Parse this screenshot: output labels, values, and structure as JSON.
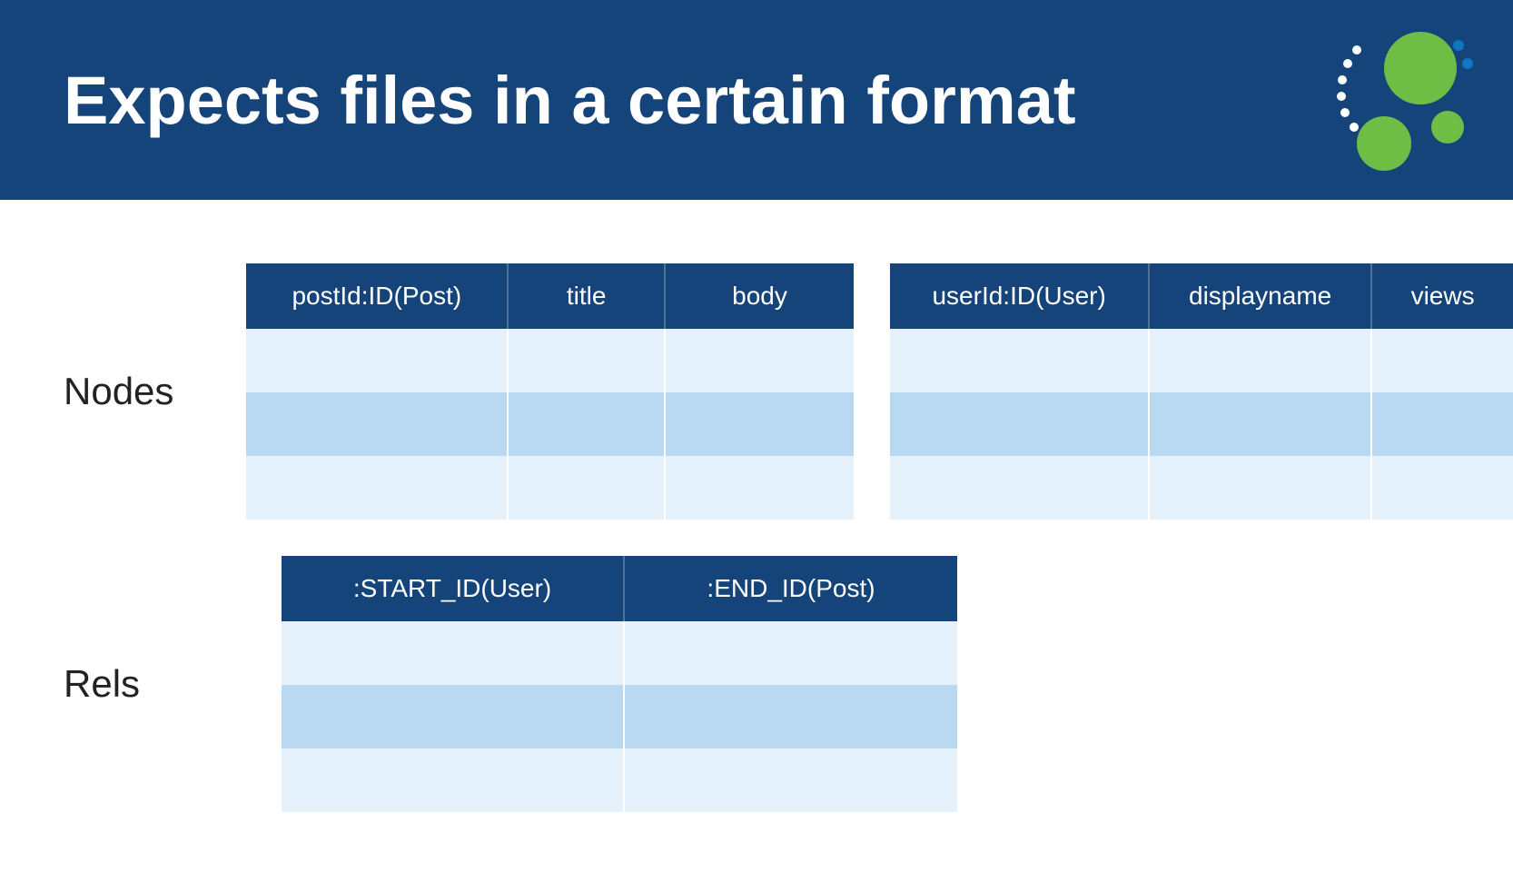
{
  "header": {
    "title": "Expects files in a certain format"
  },
  "sections": {
    "nodes_label": "Nodes",
    "rels_label": "Rels"
  },
  "tables": {
    "posts": {
      "headers": [
        "postId:ID(Post)",
        "title",
        "body"
      ]
    },
    "users": {
      "headers": [
        "userId:ID(User)",
        "displayname",
        "views"
      ]
    },
    "rels": {
      "headers": [
        ":START_ID(User)",
        ":END_ID(Post)"
      ]
    }
  },
  "colors": {
    "header_bg": "#15447a",
    "row_light": "#e6f2fb",
    "row_dark": "#b9d9f2",
    "logo_green": "#6ebe45",
    "logo_blue": "#0f76c0"
  }
}
